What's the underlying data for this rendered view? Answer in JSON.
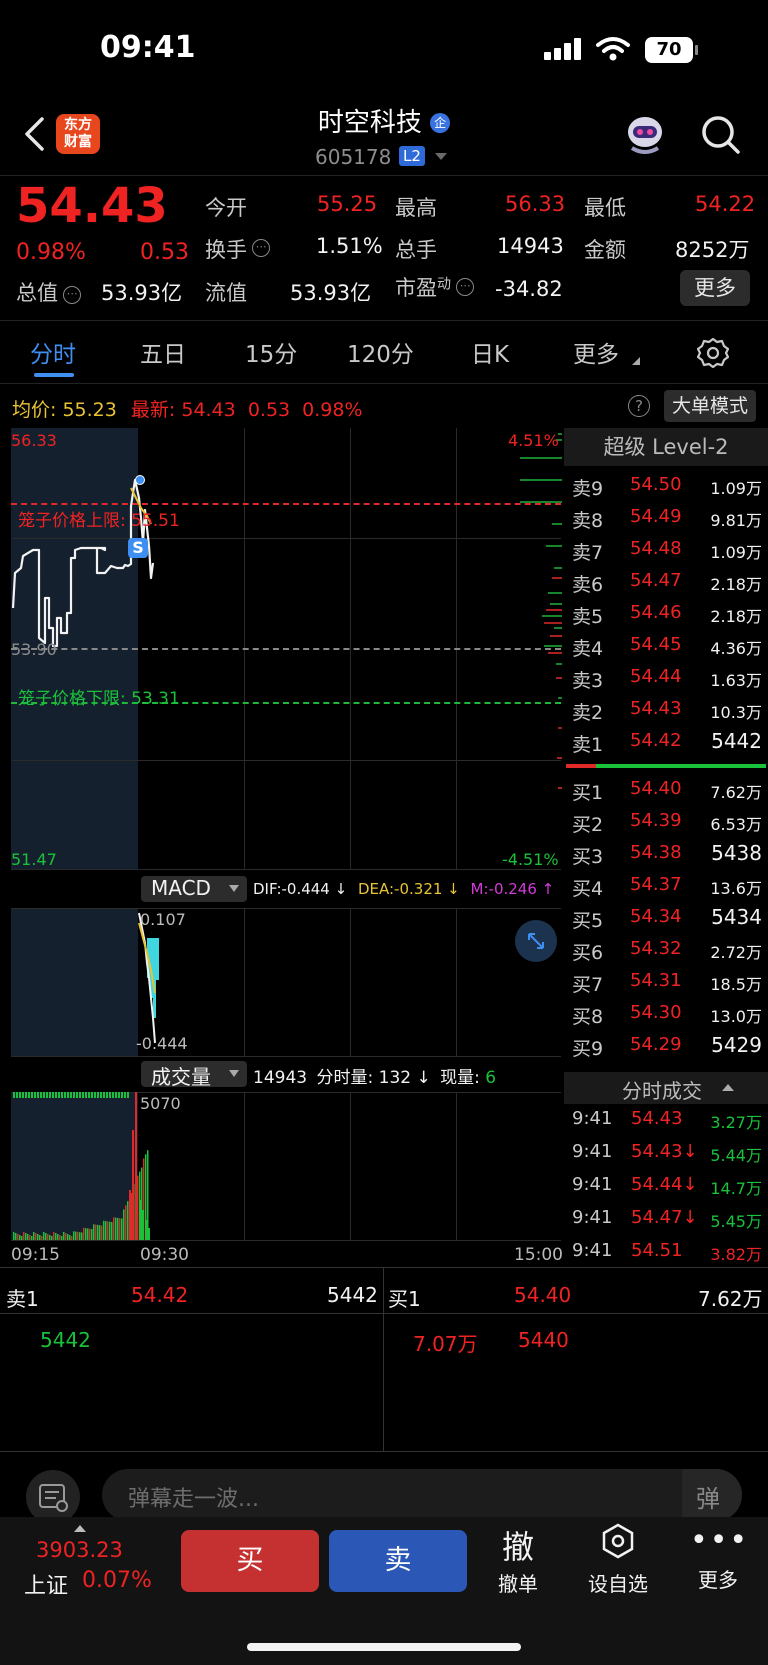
{
  "status_bar": {
    "time": "09:41",
    "battery": "70"
  },
  "header": {
    "brand": "东方\n财富",
    "name": "时空科技",
    "name_badge": "企",
    "code": "605178",
    "level_badge": "L2"
  },
  "quote": {
    "price": "54.43",
    "change_pct": "0.98%",
    "change": "0.53",
    "open_label": "今开",
    "open": "55.25",
    "high_label": "最高",
    "high": "56.33",
    "low_label": "最低",
    "low": "54.22",
    "turnover_label": "换手",
    "turnover": "1.51%",
    "volume_label": "总手",
    "volume": "14943",
    "amount_label": "金额",
    "amount": "8252万",
    "mcap_label": "总值",
    "mcap": "53.93亿",
    "float_label": "流值",
    "float_cap": "53.93亿",
    "pe_label": "市盈",
    "pe_sup": "动",
    "pe": "-34.82",
    "more": "更多"
  },
  "tabs": [
    "分时",
    "五日",
    "15分",
    "120分",
    "日K",
    "更多"
  ],
  "info_bar": {
    "avg_label": "均价:",
    "avg": "55.23",
    "latest_label": "最新:",
    "latest": "54.43",
    "chg": "0.53",
    "pct": "0.98%",
    "big_order": "大单模式"
  },
  "chart": {
    "y_top": "56.33",
    "y_bottom": "51.47",
    "pct_top": "4.51%",
    "pct_bottom": "-4.51%",
    "y_mid": "53.90",
    "upper_limit": "笼子价格上限: 55.51",
    "lower_limit": "笼子价格下限: 53.31",
    "s_marker": "S",
    "time_start": "09:15",
    "time_open": "09:30",
    "time_end": "15:00"
  },
  "macd": {
    "name": "MACD",
    "dif": "DIF:-0.444 ↓",
    "dea": "DEA:-0.321 ↓",
    "m": "M:-0.246 ↑",
    "top": "0.107",
    "bottom": "-0.444"
  },
  "volume": {
    "name": "成交量",
    "total": "14943",
    "min_label": "分时量:",
    "min_val": "132 ↓",
    "now_label": "现量:",
    "now_val": "6",
    "top": "5070"
  },
  "orderbook": {
    "title": "超级 Level-2",
    "asks": [
      {
        "label": "卖9",
        "price": "54.50",
        "vol": "1.09万"
      },
      {
        "label": "卖8",
        "price": "54.49",
        "vol": "9.81万"
      },
      {
        "label": "卖7",
        "price": "54.48",
        "vol": "1.09万"
      },
      {
        "label": "卖6",
        "price": "54.47",
        "vol": "2.18万"
      },
      {
        "label": "卖5",
        "price": "54.46",
        "vol": "2.18万"
      },
      {
        "label": "卖4",
        "price": "54.45",
        "vol": "4.36万"
      },
      {
        "label": "卖3",
        "price": "54.44",
        "vol": "1.63万"
      },
      {
        "label": "卖2",
        "price": "54.43",
        "vol": "10.3万"
      },
      {
        "label": "卖1",
        "price": "54.42",
        "vol": "5442"
      }
    ],
    "bids": [
      {
        "label": "买1",
        "price": "54.40",
        "vol": "7.62万"
      },
      {
        "label": "买2",
        "price": "54.39",
        "vol": "6.53万"
      },
      {
        "label": "买3",
        "price": "54.38",
        "vol": "5438"
      },
      {
        "label": "买4",
        "price": "54.37",
        "vol": "13.6万"
      },
      {
        "label": "买5",
        "price": "54.34",
        "vol": "5434"
      },
      {
        "label": "买6",
        "price": "54.32",
        "vol": "2.72万"
      },
      {
        "label": "买7",
        "price": "54.31",
        "vol": "18.5万"
      },
      {
        "label": "买8",
        "price": "54.30",
        "vol": "13.0万"
      },
      {
        "label": "买9",
        "price": "54.29",
        "vol": "5429"
      }
    ],
    "ticks_title": "分时成交",
    "ticks": [
      {
        "time": "9:41",
        "price": "54.43",
        "vol": "3.27万"
      },
      {
        "time": "9:41",
        "price": "54.43↓",
        "vol": "5.44万"
      },
      {
        "time": "9:41",
        "price": "54.44↓",
        "vol": "14.7万"
      },
      {
        "time": "9:41",
        "price": "54.47↓",
        "vol": "5.45万"
      },
      {
        "time": "9:41",
        "price": "54.51",
        "vol": "3.82万"
      }
    ]
  },
  "queue": {
    "sell_label": "卖1",
    "sell_price": "54.42",
    "sell_vol": "5442",
    "buy_label": "买1",
    "buy_price": "54.40",
    "buy_vol": "7.62万",
    "sell_orders": [
      "5442"
    ],
    "buy_orders": [
      "7.07万",
      "5440"
    ]
  },
  "danmaku": {
    "placeholder": "弹幕走一波..."
  },
  "bottom_bar": {
    "index_value": "3903.23",
    "index_name": "上证",
    "index_pct": "0.07%",
    "buy": "买",
    "sell": "卖",
    "cancel_icon": "撤",
    "cancel": "撤单",
    "watch": "设自选",
    "more": "更多"
  }
}
